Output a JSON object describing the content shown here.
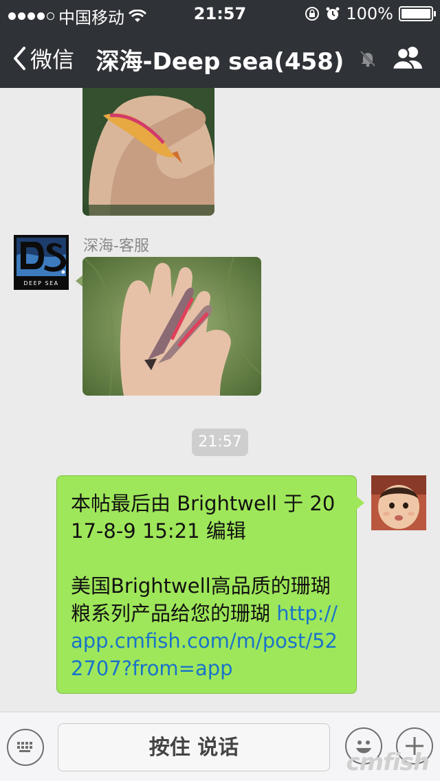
{
  "status_bar": {
    "carrier": "中国移动",
    "time": "21:57",
    "battery": "100%",
    "signal_bars_filled": 4,
    "signal_bars_total": 5
  },
  "nav": {
    "back_label": "微信",
    "title": "深海-Deep sea(458)",
    "icons": [
      "back-chevron-icon",
      "mute-bell-icon",
      "group-members-icon"
    ]
  },
  "messages": [
    {
      "type": "image",
      "direction": "incoming",
      "description_icon": "fish-photo"
    },
    {
      "type": "image",
      "direction": "incoming",
      "sender": "深海-客服",
      "avatar_text": "DEEP SEA",
      "avatar_logo": "DS"
    },
    {
      "type": "timestamp",
      "text": "21:57"
    },
    {
      "type": "text",
      "direction": "outgoing",
      "line1": "本帖最后由 Brightwell 于 2017-8-9 15:21 编辑",
      "line2": "美国Brightwell高品质的珊瑚粮系列产品给您的珊瑚 ",
      "link": "http://app.cmfish.com/m/post/522707?from=app"
    }
  ],
  "input_bar": {
    "hold_to_talk": "按住 说话",
    "icons": [
      "keyboard-icon",
      "emoji-icon",
      "plus-icon"
    ]
  },
  "watermark": "cmfish",
  "colors": {
    "header_bg": "#2f3236",
    "bubble_out": "#9fe75a",
    "link": "#1a73c8",
    "chat_bg": "#ebebeb"
  }
}
